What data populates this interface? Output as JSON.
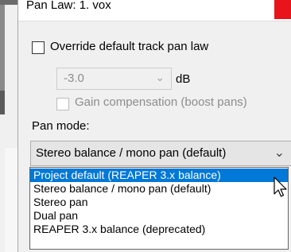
{
  "window": {
    "title": "Pan Law: 1. vox"
  },
  "pan_law": {
    "override_label": "Override default track pan law",
    "override_checked": false,
    "db_value": "-3.0",
    "db_unit": "dB",
    "gain_comp_label": "Gain compensation (boost pans)",
    "gain_comp_checked": false
  },
  "pan_mode": {
    "label": "Pan mode:",
    "current_value": "Stereo balance / mono pan (default)",
    "options": [
      "Project default (REAPER 3.x balance)",
      "Stereo balance / mono pan (default)",
      "Stereo pan",
      "Dual pan",
      "REAPER 3.x balance (deprecated)"
    ],
    "highlighted_index": 0
  },
  "colors": {
    "accent": "#0078d7",
    "close": "#e8141b"
  }
}
